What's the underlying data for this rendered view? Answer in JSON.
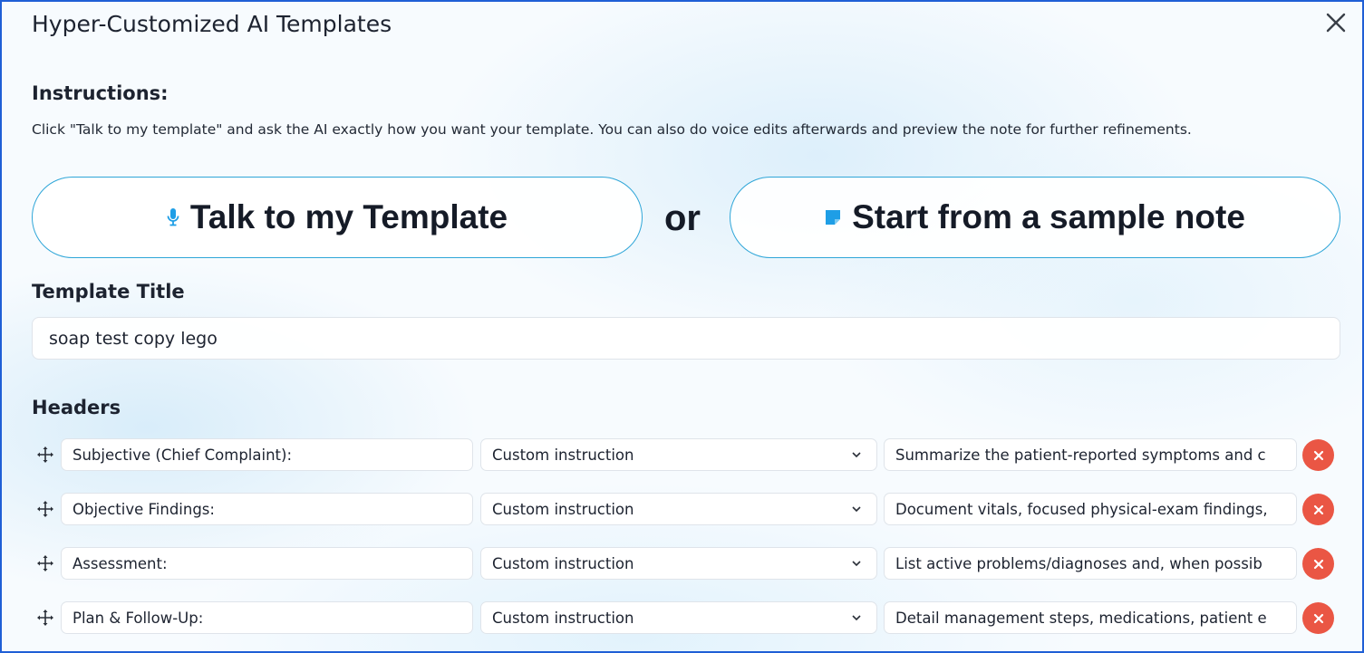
{
  "modal": {
    "title": "Hyper-Customized AI Templates",
    "close_icon": "close-icon"
  },
  "instructions": {
    "heading": "Instructions:",
    "text": "Click \"Talk to my template\" and ask the AI exactly how you want your template. You can also do voice edits afterwards and preview the note for further refinements."
  },
  "actions": {
    "talk_label": "Talk to my Template",
    "talk_icon": "microphone-icon",
    "or_label": "or",
    "sample_label": "Start from a sample note",
    "sample_icon": "sticky-note-icon"
  },
  "template_title": {
    "label": "Template Title",
    "value": "soap test copy lego"
  },
  "headers": {
    "label": "Headers",
    "rows": [
      {
        "name": "Subjective (Chief Complaint):",
        "type": "Custom instruction",
        "instruction": "Summarize the patient-reported symptoms and c"
      },
      {
        "name": "Objective Findings:",
        "type": "Custom instruction",
        "instruction": "Document vitals, focused physical-exam findings,"
      },
      {
        "name": "Assessment:",
        "type": "Custom instruction",
        "instruction": "List active problems/diagnoses and, when possib"
      },
      {
        "name": "Plan & Follow-Up:",
        "type": "Custom instruction",
        "instruction": "Detail management steps, medications, patient e"
      }
    ]
  },
  "colors": {
    "accent_border": "#1f5fd6",
    "button_border": "#2fa6d8",
    "icon_blue": "#1e9ee6",
    "delete_red": "#ea5644"
  }
}
